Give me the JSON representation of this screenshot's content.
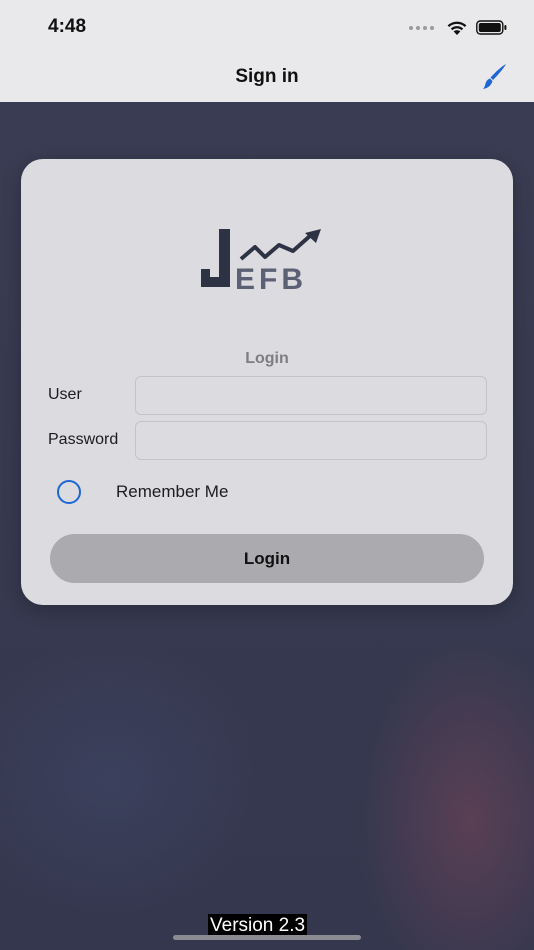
{
  "status_bar": {
    "time": "4:48",
    "icons": [
      "signal-icon",
      "wifi-icon",
      "battery-icon"
    ]
  },
  "nav": {
    "title": "Sign in",
    "right_icon": "paintbrush-icon",
    "accent_color": "#1d66d6"
  },
  "logo": {
    "text": "JEFB"
  },
  "form": {
    "section_title": "Login",
    "user_label": "User",
    "user_value": "",
    "password_label": "Password",
    "password_value": "",
    "remember_label": "Remember Me",
    "remember_checked": false,
    "submit_label": "Login"
  },
  "footer": {
    "version": "Version 2.3"
  }
}
